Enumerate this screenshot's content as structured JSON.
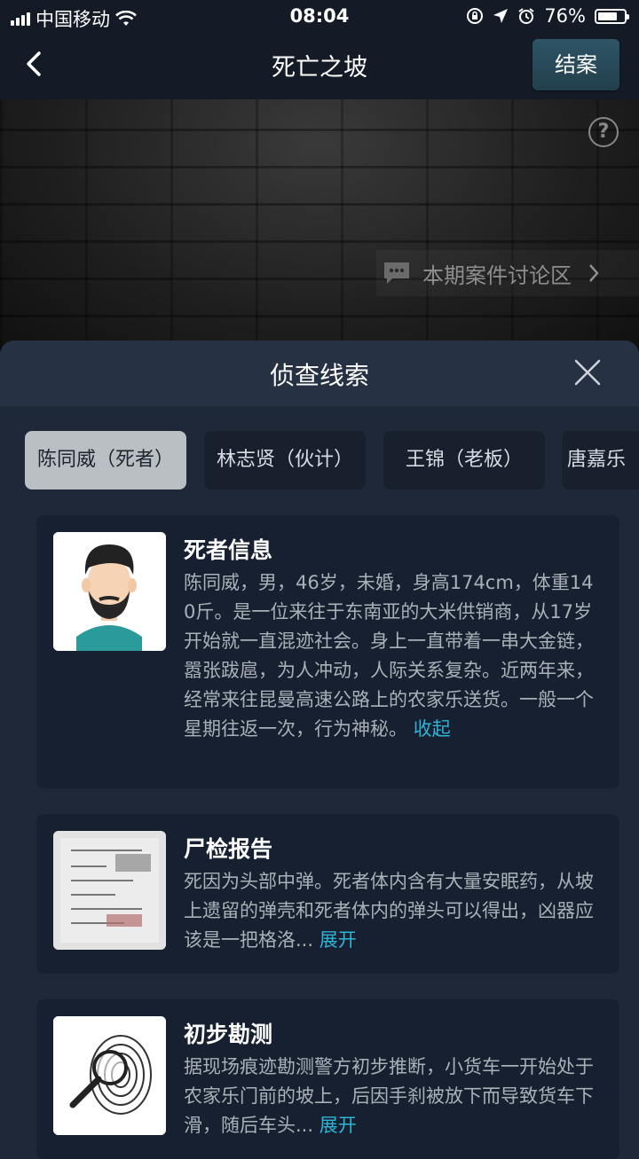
{
  "status_bar": {
    "carrier": "中国移动",
    "time": "08:04",
    "battery": "76%",
    "battery_level": 0.76
  },
  "nav": {
    "title": "死亡之坡",
    "close_case_label": "结案"
  },
  "hero": {
    "help_glyph": "?",
    "discussion_label": "本期案件讨论区"
  },
  "sheet": {
    "title": "侦查线索",
    "tabs": [
      {
        "label": "陈同威（死者）",
        "active": true
      },
      {
        "label": "林志贤（伙计）",
        "active": false
      },
      {
        "label": "王锦（老板）",
        "active": false
      },
      {
        "label": "唐嘉乐",
        "active": false
      }
    ],
    "cards": [
      {
        "title": "死者信息",
        "text": "陈同威，男，46岁，未婚，身高174cm，体重140斤。是一位来往于东南亚的大米供销商，从17岁开始就一直混迹社会。身上一直带着一串大金链，嚣张跋扈，为人冲动，人际关系复杂。近两年来，经常来往昆曼高速公路上的农家乐送货。一般一个星期往返一次，行为神秘。",
        "toggle": "收起",
        "icon": "avatar-man-icon"
      },
      {
        "title": "尸检报告",
        "text": "死因为头部中弹。死者体内含有大量安眠药，从坡上遗留的弹壳和死者体内的弹头可以得出，凶器应该是一把格洛...",
        "toggle": "展开",
        "icon": "document-photo-icon"
      },
      {
        "title": "初步勘测",
        "text": "据现场痕迹勘测警方初步推断，小货车一开始处于农家乐门前的坡上，后因手刹被放下而导致货车下滑，随后车头...",
        "toggle": "展开",
        "icon": "fingerprint-magnifier-icon"
      }
    ]
  },
  "colors": {
    "accent": "#2fb4d6",
    "sheet_bg": "#1f2838",
    "card_bg": "#172030"
  }
}
